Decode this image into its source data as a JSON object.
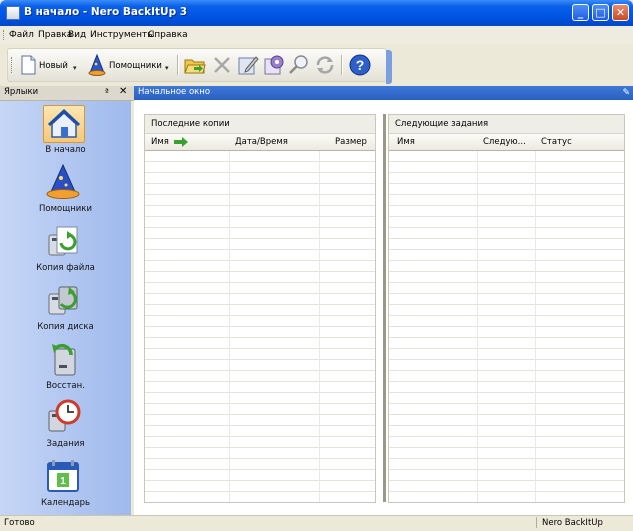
{
  "window": {
    "title": "В начало - Nero BackItUp 3",
    "controls": {
      "minimize": "_",
      "maximize": "□",
      "close": "✕"
    }
  },
  "menu": {
    "items": [
      {
        "label": "Файл"
      },
      {
        "label": "Правка"
      },
      {
        "label": "Вид"
      },
      {
        "label": "Инструменты"
      },
      {
        "label": "Справка"
      }
    ]
  },
  "toolbar": {
    "new_label": "Новый",
    "wizards_label": "Помощники",
    "icons": [
      "new-doc-icon",
      "wizard-icon",
      "open-folder-icon",
      "delete-icon",
      "edit-icon",
      "properties-icon",
      "search-icon",
      "refresh-icon",
      "help-icon"
    ]
  },
  "sidebar": {
    "title": "Ярлыки",
    "pin": "ª",
    "close": "✕",
    "items": [
      {
        "label": "В начало",
        "icon": "home-icon"
      },
      {
        "label": "Помощники",
        "icon": "wizard-hat-icon"
      },
      {
        "label": "Копия файла",
        "icon": "file-backup-icon"
      },
      {
        "label": "Копия диска",
        "icon": "disk-backup-icon"
      },
      {
        "label": "Восстан.",
        "icon": "restore-icon"
      },
      {
        "label": "Задания",
        "icon": "jobs-clock-icon"
      },
      {
        "label": "Календарь",
        "icon": "calendar-icon"
      }
    ]
  },
  "main": {
    "title": "Начальное окно",
    "left_panel": {
      "title": "Последние копии",
      "columns": [
        "Имя",
        "Дата/Время",
        "Размер"
      ]
    },
    "right_panel": {
      "title": "Следующие задания",
      "columns": [
        "Имя",
        "Следую...",
        "Статус"
      ]
    }
  },
  "statusbar": {
    "left": "Готово",
    "right": "Nero BackItUp"
  },
  "colors": {
    "titlebar": "#0055E5",
    "main_header": "#2A5FC0",
    "sidebar_gradient_start": "#C6D6F6",
    "sidebar_gradient_end": "#9FB9EC"
  }
}
